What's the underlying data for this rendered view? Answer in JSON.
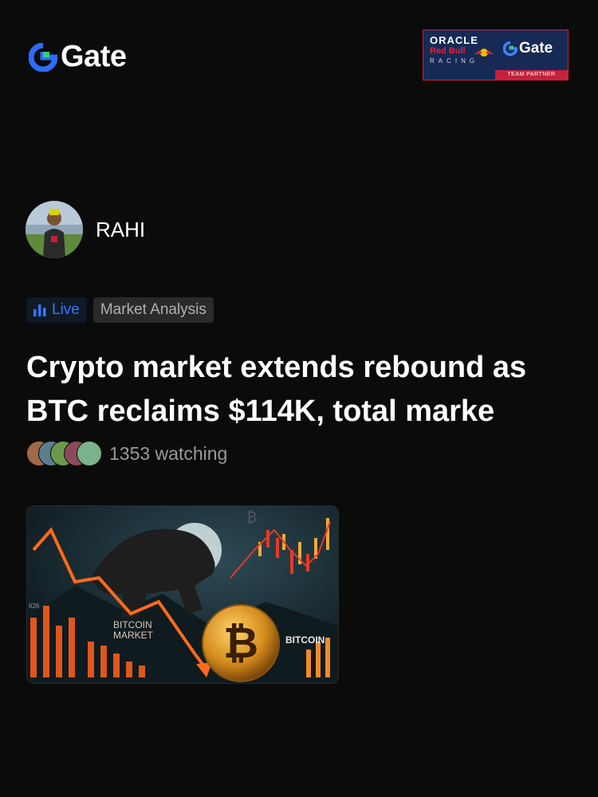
{
  "brand": {
    "name": "Gate",
    "logo_icon": "gate-logo-icon"
  },
  "partner_badge": {
    "oracle": "ORACLE",
    "redbull": "Red Bull",
    "racing": "RACING",
    "gate": "Gate",
    "caption": "TEAM PARTNER"
  },
  "author": {
    "name": "RAHI"
  },
  "tags": {
    "live": "Live",
    "category": "Market Analysis"
  },
  "post": {
    "title": "Crypto market extends rebound as BTC reclaims $114K, total marke",
    "watching": "1353 watching"
  },
  "cover_image": {
    "bitcoin_market": "BITCOIN",
    "market": "MARKET",
    "bitcoin_right": "BITCOIN",
    "axis_tick": "626"
  },
  "colors": {
    "accent": "#2f78ff",
    "background": "#0b0b0b",
    "brand_green": "#2fd478"
  }
}
